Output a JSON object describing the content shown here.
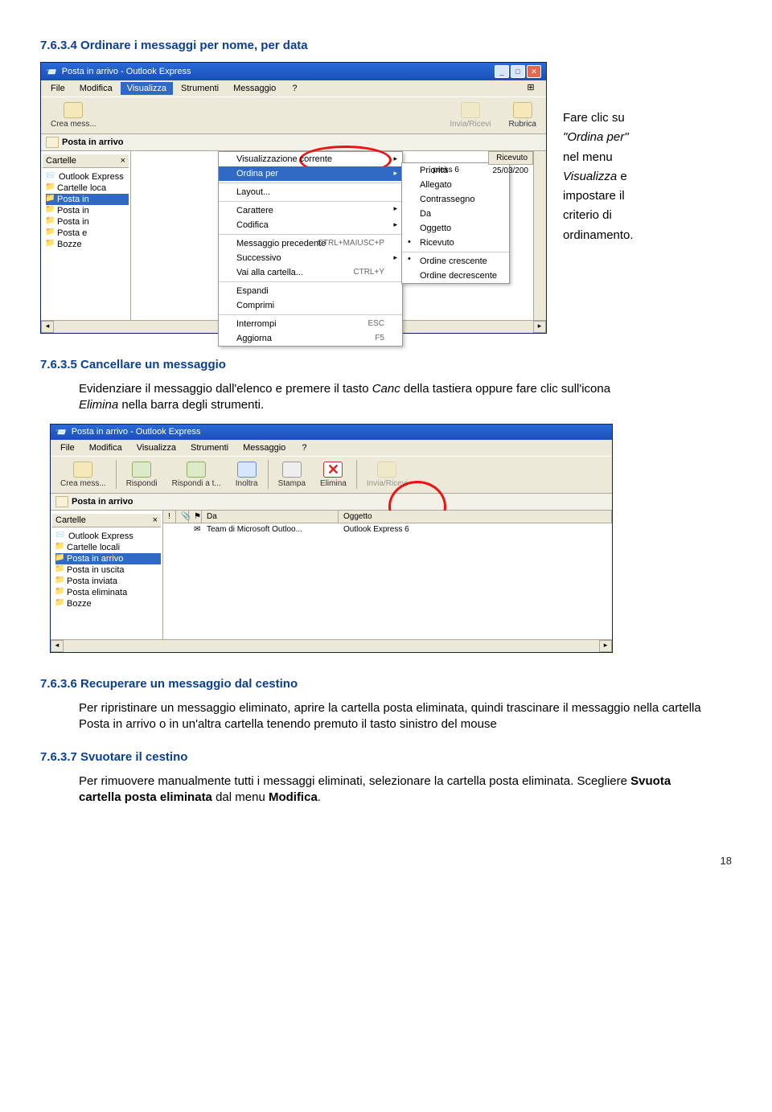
{
  "headings": {
    "h1": "7.6.3.4  Ordinare i messaggi per nome, per data",
    "h2": "7.6.3.5  Cancellare un messaggio",
    "h3": "7.6.3.6  Recuperare un messaggio dal cestino",
    "h4": "7.6.3.7  Svuotare il cestino"
  },
  "side": {
    "l1": "Fare clic su",
    "l2": "\"Ordina per\"",
    "l3": "nel menu",
    "l4": "Visualizza",
    "l5": " e",
    "l6": "impostare il",
    "l7": "criterio di",
    "l8": "ordinamento."
  },
  "p2a": "Evidenziare il messaggio dall'elenco e premere il tasto ",
  "p2b": "Canc",
  "p2c": " della tastiera oppure fare clic sull'icona",
  "p2d": "Elimina",
  "p2e": " nella barra degli strumenti.",
  "p3": "Per ripristinare un messaggio eliminato, aprire la cartella posta eliminata, quindi trascinare il messaggio nella cartella Posta in arrivo o in un'altra cartella tenendo premuto il tasto sinistro del mouse",
  "p4a": "Per rimuovere manualmente tutti i messaggi eliminati, selezionare la cartella posta eliminata. Scegliere ",
  "p4b": "Svuota cartella posta eliminata",
  "p4c": " dal menu ",
  "p4d": "Modifica",
  "p4e": ".",
  "pagenum": "18",
  "oe": {
    "title": "Posta in arrivo - Outlook Express",
    "menus": [
      "File",
      "Modifica",
      "Visualizza",
      "Strumenti",
      "Messaggio",
      "?"
    ],
    "tb": {
      "crea": "Crea mess...",
      "invia": "Invia/Ricevi",
      "rubrica": "Rubrica"
    },
    "addr": "Posta in arrivo",
    "foldershdr": "Cartelle",
    "tree": [
      "Outlook Express",
      "Cartelle loca",
      "Posta in",
      "Posta in",
      "Posta in",
      "Posta e",
      "Bozze"
    ],
    "view_menu": [
      {
        "t": "Visualizzazione corrente",
        "sub": true
      },
      {
        "t": "Ordina per",
        "sub": true,
        "hi": true
      },
      {
        "t": "Layout...",
        "sep": true
      },
      {
        "t": "Carattere",
        "sub": true,
        "sep": true
      },
      {
        "t": "Codifica",
        "sub": true
      },
      {
        "t": "Messaggio precedente",
        "sc": "CTRL+MAIUSC+P",
        "sep": true
      },
      {
        "t": "Successivo",
        "sub": true
      },
      {
        "t": "Vai alla cartella...",
        "sc": "CTRL+Y"
      },
      {
        "t": "Espandi",
        "sep": true
      },
      {
        "t": "Comprimi"
      },
      {
        "t": "Interrompi",
        "sc": "ESC",
        "sep": true
      },
      {
        "t": "Aggiorna",
        "sc": "F5"
      }
    ],
    "sort_menu": [
      {
        "t": "Priorità"
      },
      {
        "t": "Allegato"
      },
      {
        "t": "Contrassegno"
      },
      {
        "t": "Da"
      },
      {
        "t": "Oggetto"
      },
      {
        "t": "Ricevuto",
        "dot": true
      },
      {
        "t": "Ordine crescente",
        "sep": true,
        "dot": true
      },
      {
        "t": "Ordine decrescente"
      }
    ],
    "listhdr2": "press 6",
    "listhdr3": "Ricevuto",
    "listcell": "25/03/200"
  },
  "oe2": {
    "title": "Posta in arrivo - Outlook Express",
    "menus": [
      "File",
      "Modifica",
      "Visualizza",
      "Strumenti",
      "Messaggio",
      "?"
    ],
    "tb": {
      "crea": "Crea mess...",
      "risp": "Rispondi",
      "rispt": "Rispondi a t...",
      "inoltra": "Inoltra",
      "stampa": "Stampa",
      "elimina": "Elimina",
      "invia": "Invia/Ricevi"
    },
    "addr": "Posta in arrivo",
    "foldershdr": "Cartelle",
    "tree": [
      "Outlook Express",
      "Cartelle locali",
      "Posta in arrivo",
      "Posta in uscita",
      "Posta inviata",
      "Posta eliminata",
      "Bozze"
    ],
    "cols": {
      "da": "Da",
      "ogg": "Oggetto"
    },
    "row": {
      "da": "Team di Microsoft Outloo...",
      "ogg": "Outlook Express 6"
    }
  }
}
